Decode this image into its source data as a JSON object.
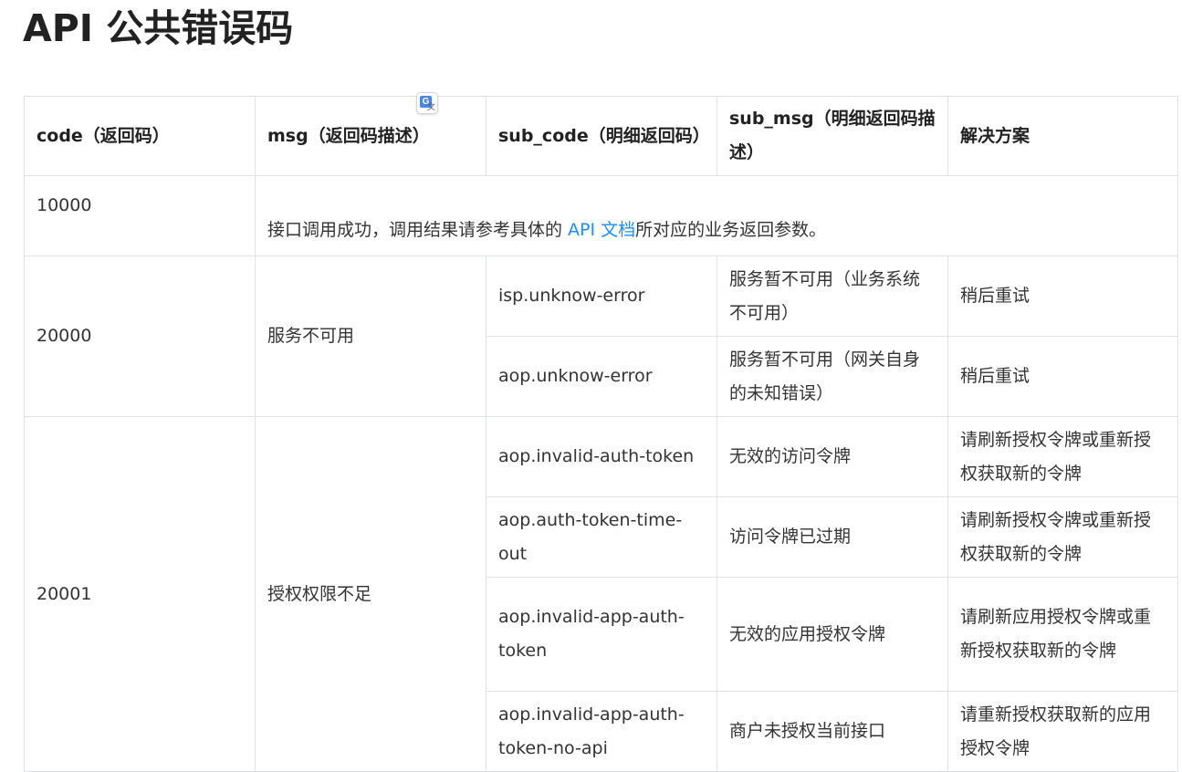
{
  "title": "API 公共错误码",
  "table": {
    "headers": [
      "code（返回码）",
      "msg（返回码描述）",
      "sub_code（明细返回码）",
      "sub_msg（明细返回码描述）",
      "解决方案"
    ],
    "row_10000": {
      "code": "10000",
      "desc_prefix": "接口调用成功，调用结果请参考具体的 ",
      "desc_link": "API 文档",
      "desc_suffix": "所对应的业务返回参数。"
    },
    "group_20000": {
      "code": "20000",
      "msg": "服务不可用",
      "rows": [
        {
          "sub_code": "isp.unknow-error",
          "sub_msg": "服务暂不可用（业务系统不可用）",
          "solution": "稍后重试"
        },
        {
          "sub_code": "aop.unknow-error",
          "sub_msg": "服务暂不可用（网关自身的未知错误）",
          "solution": "稍后重试"
        }
      ]
    },
    "group_20001": {
      "code": "20001",
      "msg": "授权权限不足",
      "rows": [
        {
          "sub_code": "aop.invalid-auth-token",
          "sub_msg": "无效的访问令牌",
          "solution": "请刷新授权令牌或重新授权获取新的令牌"
        },
        {
          "sub_code": "aop.auth-token-time-out",
          "sub_msg": "访问令牌已过期",
          "solution": "请刷新授权令牌或重新授权获取新的令牌"
        },
        {
          "sub_code": "aop.invalid-app-auth-token",
          "sub_msg": "无效的应用授权令牌",
          "solution": "请刷新应用授权令牌或重新授权获取新的令牌"
        },
        {
          "sub_code": "aop.invalid-app-auth-token-no-api",
          "sub_msg": "商户未授权当前接口",
          "solution": "请重新授权获取新的应用授权令牌"
        }
      ]
    }
  }
}
